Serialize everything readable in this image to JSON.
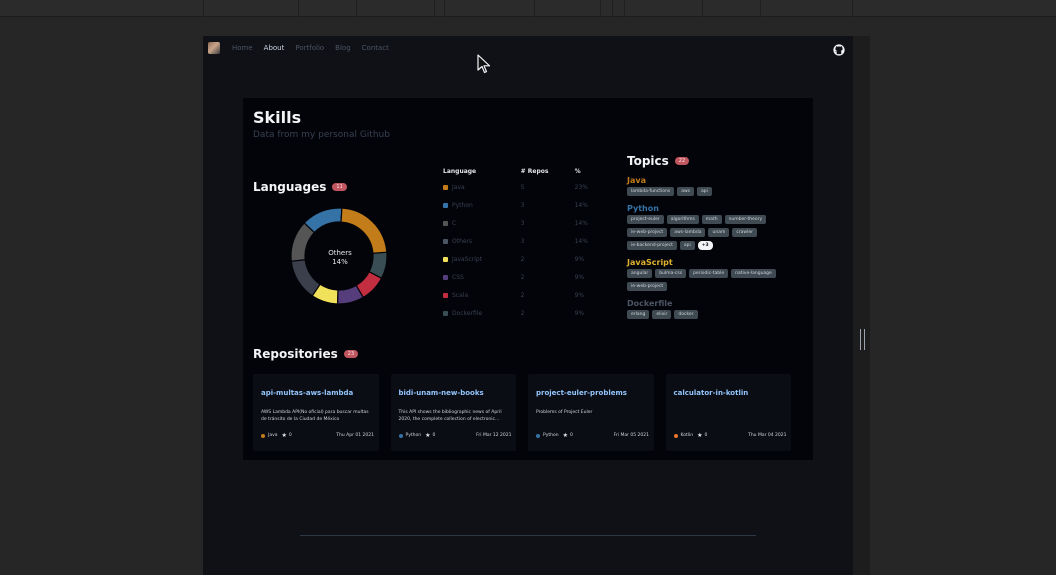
{
  "nav": {
    "links": [
      "Home",
      "About",
      "Portfolio",
      "Blog",
      "Contact"
    ]
  },
  "skills": {
    "title": "Skills",
    "subtitle": "Data from my personal Github"
  },
  "languages": {
    "title": "Languages",
    "count": "11",
    "center_label": "Others",
    "center_value": "14%",
    "headers": [
      "Language",
      "# Repos",
      "%"
    ],
    "rows": [
      {
        "name": "Java",
        "repos": "5",
        "pct": "23%",
        "color": "#c27c1a"
      },
      {
        "name": "Python",
        "repos": "3",
        "pct": "14%",
        "color": "#3572a5"
      },
      {
        "name": "C",
        "repos": "3",
        "pct": "14%",
        "color": "#555555"
      },
      {
        "name": "Others",
        "repos": "3",
        "pct": "14%",
        "color": "#4b5563"
      },
      {
        "name": "JavaScript",
        "repos": "2",
        "pct": "9%",
        "color": "#f1e05a"
      },
      {
        "name": "CSS",
        "repos": "2",
        "pct": "9%",
        "color": "#563d7c"
      },
      {
        "name": "Scala",
        "repos": "2",
        "pct": "9%",
        "color": "#c22d40"
      },
      {
        "name": "Dockerfile",
        "repos": "2",
        "pct": "9%",
        "color": "#384d54"
      }
    ]
  },
  "topics": {
    "title": "Topics",
    "count": "22",
    "groups": [
      {
        "name": "Java",
        "color": "#c27c1a",
        "tags": [
          "lambda-functions",
          "aws",
          "api"
        ]
      },
      {
        "name": "Python",
        "color": "#3572a5",
        "tags": [
          "project-euler",
          "algorithms",
          "math",
          "number-theory",
          "ie-web-project",
          "aws-lambda",
          "unam",
          "crawler",
          "ie-backend-project",
          "api"
        ],
        "more": "+3"
      },
      {
        "name": "JavaScript",
        "color": "#e0b32e",
        "tags": [
          "angular",
          "bulma-css",
          "periodic-table",
          "native-language",
          "ie-web-project"
        ]
      },
      {
        "name": "Dockerfile",
        "color": "#4b5563",
        "tags": [
          "erlang",
          "elixir",
          "docker"
        ]
      }
    ]
  },
  "repositories": {
    "title": "Repositories",
    "count": "23",
    "items": [
      {
        "name": "api-multas-aws-lambda",
        "desc": "AWS Lambda API(No oficial) para buscar multas de tránsito de la Ciudad de México",
        "lang": "Java",
        "lang_color": "#c27c1a",
        "stars": "0",
        "date": "Thu Apr 01 2021"
      },
      {
        "name": "bidi-unam-new-books",
        "desc": "This API shows the bibliographic news of April 2020, the complete collection of electronic...",
        "lang": "Python",
        "lang_color": "#3572a5",
        "stars": "0",
        "date": "Fri Mar 12 2021"
      },
      {
        "name": "project-euler-problems",
        "desc": "Problems of Project Euler",
        "lang": "Python",
        "lang_color": "#3572a5",
        "stars": "0",
        "date": "Fri Mar 05 2021"
      },
      {
        "name": "calculator-in-kotlin",
        "desc": "",
        "lang": "Kotlin",
        "lang_color": "#e8742a",
        "stars": "0",
        "date": "Thu Mar 04 2021"
      }
    ]
  },
  "donut_segments": [
    {
      "name": "Java",
      "value": 23,
      "color": "#c27c1a"
    },
    {
      "name": "Dockerfile",
      "value": 9,
      "color": "#384d54"
    },
    {
      "name": "Scala",
      "value": 9,
      "color": "#c22d40"
    },
    {
      "name": "CSS",
      "value": 9,
      "color": "#563d7c"
    },
    {
      "name": "JavaScript",
      "value": 9,
      "color": "#f1e05a"
    },
    {
      "name": "Others",
      "value": 14,
      "color": "#3a3f4b"
    },
    {
      "name": "C",
      "value": 14,
      "color": "#555555"
    },
    {
      "name": "Python",
      "value": 14,
      "color": "#3572a5"
    }
  ]
}
